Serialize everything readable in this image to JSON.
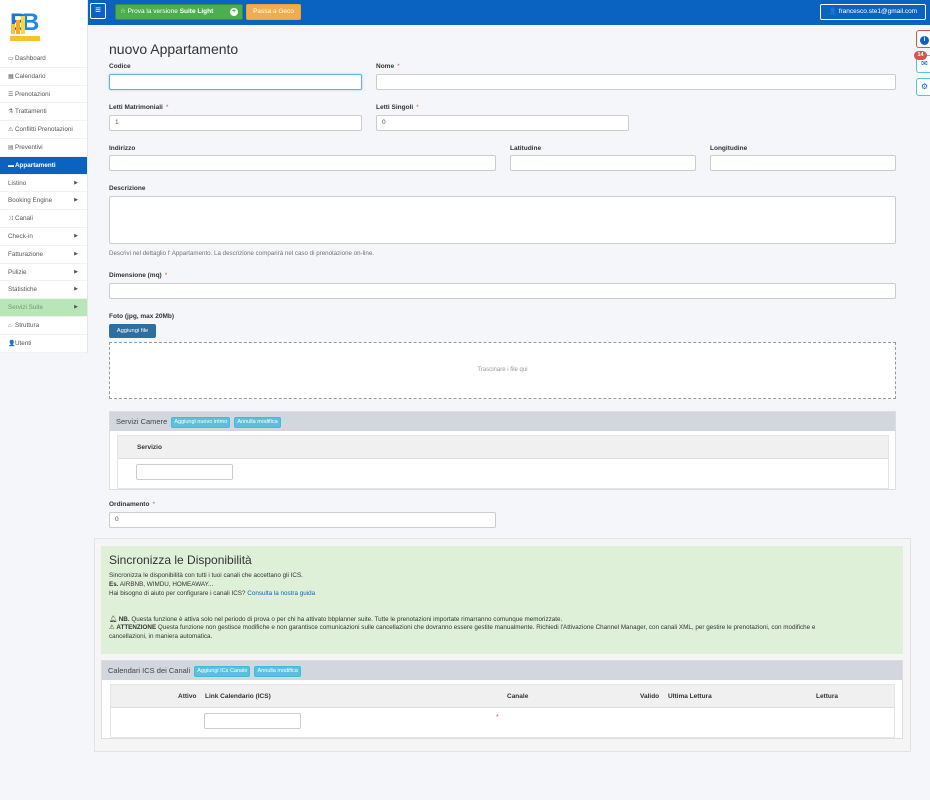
{
  "sidebar": {
    "items": [
      {
        "icon": "laptop-icon",
        "glyph": "▭",
        "label": "Dashboard",
        "caret": false,
        "active": false
      },
      {
        "icon": "calendar-icon",
        "glyph": "▦",
        "label": "Calendario",
        "caret": false,
        "active": false
      },
      {
        "icon": "list-icon",
        "glyph": "☰",
        "label": "Prenotazioni",
        "caret": false,
        "active": false
      },
      {
        "icon": "flask-icon",
        "glyph": "⚗",
        "label": "Trattamenti",
        "caret": false,
        "active": false
      },
      {
        "icon": "warning-icon",
        "glyph": "⚠",
        "label": "Conflitti Prenotazioni",
        "caret": false,
        "active": false
      },
      {
        "icon": "file-icon",
        "glyph": "▤",
        "label": "Preventivi",
        "caret": false,
        "active": false
      },
      {
        "icon": "bed-icon",
        "glyph": "▬",
        "label": "Appartamenti",
        "caret": false,
        "active": true
      },
      {
        "icon": "",
        "glyph": "",
        "label": "Listino",
        "caret": true,
        "active": false
      },
      {
        "icon": "",
        "glyph": "",
        "label": "Booking Engine",
        "caret": true,
        "active": false
      },
      {
        "icon": "random-icon",
        "glyph": "⤨",
        "label": "Canali",
        "caret": false,
        "active": false
      },
      {
        "icon": "",
        "glyph": "",
        "label": "Check-in",
        "caret": true,
        "active": false
      },
      {
        "icon": "",
        "glyph": "",
        "label": "Fatturazione",
        "caret": true,
        "active": false
      },
      {
        "icon": "",
        "glyph": "",
        "label": "Pulizie",
        "caret": true,
        "active": false
      },
      {
        "icon": "",
        "glyph": "",
        "label": "Statistiche",
        "caret": true,
        "active": false
      },
      {
        "icon": "",
        "glyph": "",
        "label": "Servizi Suite",
        "caret": true,
        "active": false,
        "suite": true
      },
      {
        "icon": "building-icon",
        "glyph": "⌂",
        "label": "Struttura",
        "caret": false,
        "active": false
      },
      {
        "icon": "user-icon",
        "glyph": "👤",
        "label": "Utenti",
        "caret": false,
        "active": false
      }
    ]
  },
  "topbar": {
    "suite_prefix": "Prova la versione",
    "suite_bold": "Suite Light",
    "geco_label": "Passa a Geco",
    "user_email": "francesco.ste1@gmail.com",
    "notifications_count": "14"
  },
  "form": {
    "title": "nuovo Appartamento",
    "codice_label": "Codice",
    "codice_value": "",
    "nome_label": "Nome",
    "nome_value": "",
    "letti_matrimoniali_label": "Letti Matrimoniali",
    "letti_matrimoniali_value": "1",
    "letti_singoli_label": "Letti Singoli",
    "letti_singoli_value": "0",
    "indirizzo_label": "Indirizzo",
    "latitudine_label": "Latitudine",
    "longitudine_label": "Longitudine",
    "descrizione_label": "Descrizione",
    "descrizione_help": "Descrivi nel dettaglio l' Appartamento. La descrizione comparirà nel caso di prenotazione on-line.",
    "dimensione_label": "Dimensione (mq)",
    "foto_label": "Foto (jpg, max 20Mb)",
    "aggiungi_file_label": "Aggiungi file",
    "dropzone_text": "Trascinare i file qui",
    "ordinamento_label": "Ordinamento",
    "ordinamento_value": "0",
    "required_mark": "*"
  },
  "servizi": {
    "title": "Servizi Camere",
    "add_label": "Aggiungi nuovo intmo",
    "cancel_label": "Annulla modifica",
    "col_servizio": "Servizio"
  },
  "sync": {
    "title": "Sincronizza le Disponibilità",
    "line1": "Sincronizza le disponibilità con tutti i tuoi canali che accettano gli ICS.",
    "line2_bold": "Es.",
    "line2": "AIRBNB, WIMDU, HOMEAWAY...",
    "line3": "Hai bisogno di aiuto per configurare i canali ICS?",
    "guide_link": "Consulta la nostra guida",
    "nb_bold": "NB.",
    "nb_text": "Questa funzione è attiva solo nel periodo di prova o per chi ha attivato bbplanner suite. Tutte le prenotazioni importate rimarranno comunque memorizzate.",
    "att_bold": "ATTENZIONE",
    "att_text": "Questa funzione non gestisce modifiche e non garantisce comunicazioni sulle cancellazioni che dovranno essere gestite manualmente. Richiedi l'Attivazione Channel Manager, con canali XML, per gestire le prenotazioni, con modifiche e",
    "att_text2": "cancellazioni, in maniera automatica."
  },
  "ics": {
    "title": "Calendari ICS dei Canali",
    "add_label": "Aggiungi ICs Canale",
    "cancel_label": "Annulla modifica",
    "col_attivo": "Attivo",
    "col_link": "Link Calendario (ICS)",
    "col_canale": "Canale",
    "col_valido": "Valido",
    "col_ultima": "Ultima Lettura",
    "col_lettura": "Lettura",
    "required_mark": "*"
  },
  "colors": {
    "primary": "#0b63c1",
    "success": "#4cae4c",
    "warning": "#f0ad4e",
    "info": "#5bc0de",
    "danger": "#d9534f",
    "sync_bg": "#dff0d8"
  }
}
